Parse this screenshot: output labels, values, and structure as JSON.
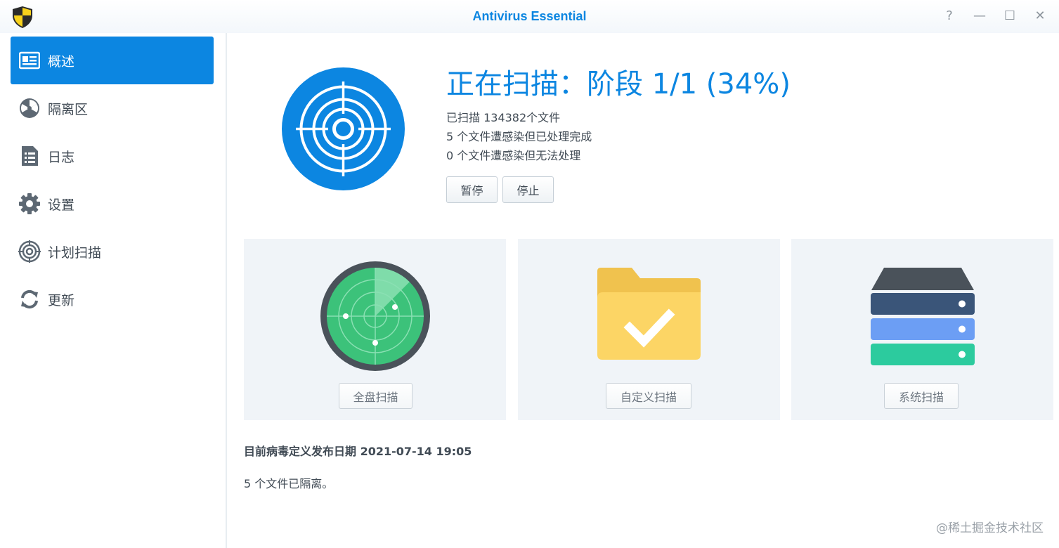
{
  "window": {
    "title": "Antivirus Essential",
    "controls": {
      "help": "?",
      "minimize": "—",
      "maximize": "☐",
      "close": "✕"
    }
  },
  "sidebar": {
    "items": [
      {
        "label": "概述",
        "icon": "overview-card-icon",
        "active": true
      },
      {
        "label": "隔离区",
        "icon": "radiation-icon",
        "active": false
      },
      {
        "label": "日志",
        "icon": "log-document-icon",
        "active": false
      },
      {
        "label": "设置",
        "icon": "gear-icon",
        "active": false
      },
      {
        "label": "计划扫描",
        "icon": "target-icon",
        "active": false
      },
      {
        "label": "更新",
        "icon": "refresh-icon",
        "active": false
      }
    ]
  },
  "status": {
    "title": "正在扫描：阶段 1/1 (34%)",
    "progress_percent": 34,
    "scanned": "已扫描 134382个文件",
    "infected_handled": "5 个文件遭感染但已处理完成",
    "infected_unhandled": "0 个文件遭感染但无法处理",
    "pause_label": "暂停",
    "stop_label": "停止"
  },
  "scan_cards": [
    {
      "label": "全盘扫描",
      "icon": "radar-icon"
    },
    {
      "label": "自定义扫描",
      "icon": "folder-check-icon"
    },
    {
      "label": "系统扫描",
      "icon": "server-stack-icon"
    }
  ],
  "footer": {
    "definition_date": "目前病毒定义发布日期 2021-07-14 19:05",
    "quarantined": "5 个文件已隔离。",
    "watermark": "@稀土掘金技术社区"
  },
  "colors": {
    "accent": "#0c86e1",
    "card_bg": "#f0f4f8",
    "radar_green": "#3cc27a",
    "folder_yellow": "#fcd565",
    "server_dark": "#3a5579",
    "server_blue": "#6c9ef4",
    "server_teal": "#2ccb9e"
  }
}
